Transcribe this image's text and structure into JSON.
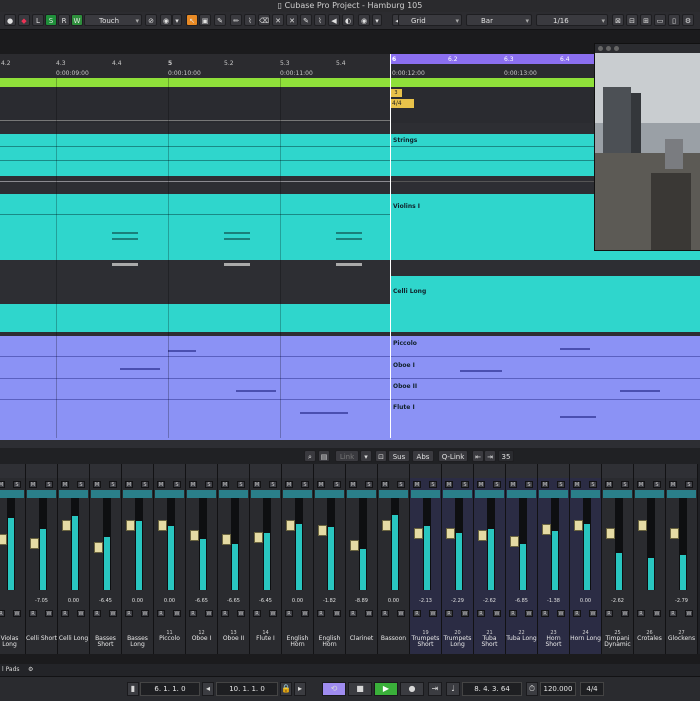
{
  "window": {
    "title": "Cubase Pro Project - Hamburg 105"
  },
  "toolbar": {
    "buttons": [
      "L",
      "S",
      "R",
      "W",
      "A"
    ],
    "automation_mode": "Touch",
    "snap_type": "Grid",
    "grid_type": "Bar",
    "quantize": "1/16"
  },
  "ruler": {
    "bars": [
      "4.2",
      "4.3",
      "4.4",
      "5",
      "5.2",
      "5.3",
      "5.4",
      "6",
      "6.2",
      "6.3",
      "6.4"
    ],
    "times": [
      "0:00:09:00",
      "0:00:10:00",
      "0:00:11:00",
      "0:00:12:00",
      "0:00:13:00"
    ]
  },
  "markers": {
    "marker_num": "3",
    "signature": "4/4"
  },
  "tracks": [
    {
      "label": "Strings"
    },
    {
      "label": "Violins I"
    },
    {
      "label": "Celli Long"
    },
    {
      "label": "Piccolo"
    },
    {
      "label": "Oboe I"
    },
    {
      "label": "Oboe II"
    },
    {
      "label": "Flute I"
    }
  ],
  "lower_toolbar": {
    "link": "Link",
    "sus": "Sus",
    "abs": "Abs",
    "qlink": "Q-Link",
    "value": "35"
  },
  "mixer": {
    "channels": [
      {
        "num": "",
        "name": "Violas Long",
        "value": "",
        "meter": 0.78,
        "fader": 0.55
      },
      {
        "num": "",
        "name": "Celli Short",
        "value": "-7.05",
        "meter": 0.66,
        "fader": 0.5
      },
      {
        "num": "",
        "name": "Celli Long",
        "value": "0.00",
        "meter": 0.8,
        "fader": 0.72
      },
      {
        "num": "",
        "name": "Basses Short",
        "value": "-6.45",
        "meter": 0.58,
        "fader": 0.45
      },
      {
        "num": "",
        "name": "Basses Long",
        "value": "0.00",
        "meter": 0.75,
        "fader": 0.72
      },
      {
        "num": "",
        "name": "Piccolo",
        "value": "0.00",
        "meter": 0.7,
        "fader": 0.72
      },
      {
        "num": "",
        "name": "Oboe I",
        "value": "-6.65",
        "meter": 0.55,
        "fader": 0.6
      },
      {
        "num": "",
        "name": "Oboe II",
        "value": "-6.65",
        "meter": 0.5,
        "fader": 0.55
      },
      {
        "num": "",
        "name": "Flute I",
        "value": "-6.45",
        "meter": 0.62,
        "fader": 0.58
      },
      {
        "num": "",
        "name": "English Horn",
        "value": "0.00",
        "meter": 0.72,
        "fader": 0.72
      },
      {
        "num": "",
        "name": "English Horn",
        "value": "-1.82",
        "meter": 0.68,
        "fader": 0.66
      },
      {
        "num": "",
        "name": "Clarinet",
        "value": "-8.89",
        "meter": 0.45,
        "fader": 0.48
      },
      {
        "num": "",
        "name": "Bassoon",
        "value": "0.00",
        "meter": 0.82,
        "fader": 0.72
      },
      {
        "num": "",
        "name": "Trumpets Short",
        "value": "-2.13",
        "meter": 0.7,
        "fader": 0.62
      },
      {
        "num": "",
        "name": "Trumpets Long",
        "value": "-2.29",
        "meter": 0.62,
        "fader": 0.62
      },
      {
        "num": "",
        "name": "Tuba Short",
        "value": "-2.62",
        "meter": 0.66,
        "fader": 0.6
      },
      {
        "num": "",
        "name": "Tuba Long",
        "value": "-6.85",
        "meter": 0.5,
        "fader": 0.52
      },
      {
        "num": "",
        "name": "Horn Short",
        "value": "-1.38",
        "meter": 0.64,
        "fader": 0.68
      },
      {
        "num": "",
        "name": "Horn Long",
        "value": "0.00",
        "meter": 0.72,
        "fader": 0.72
      },
      {
        "num": "",
        "name": "Timpani Dynamic",
        "value": "-2.62",
        "meter": 0.4,
        "fader": 0.62
      },
      {
        "num": "",
        "name": "Crotales",
        "value": "",
        "meter": 0.35,
        "fader": 0.72
      },
      {
        "num": "",
        "name": "Glockens",
        "value": "-2.79",
        "meter": 0.38,
        "fader": 0.62
      }
    ],
    "channel_numbers": [
      "",
      "",
      "",
      "",
      "",
      "11",
      "12",
      "13",
      "14",
      "",
      "",
      "",
      "",
      "19",
      "20",
      "21",
      "22",
      "23",
      "24",
      "25",
      "26",
      "27"
    ]
  },
  "bottom": {
    "instrument": "l Pads"
  },
  "transport": {
    "left_locator": "6. 1. 1.   0",
    "right_locator": "10. 1. 1.   0",
    "position": "8. 4. 3. 64",
    "tempo": "120.000",
    "signature": "4/4"
  }
}
